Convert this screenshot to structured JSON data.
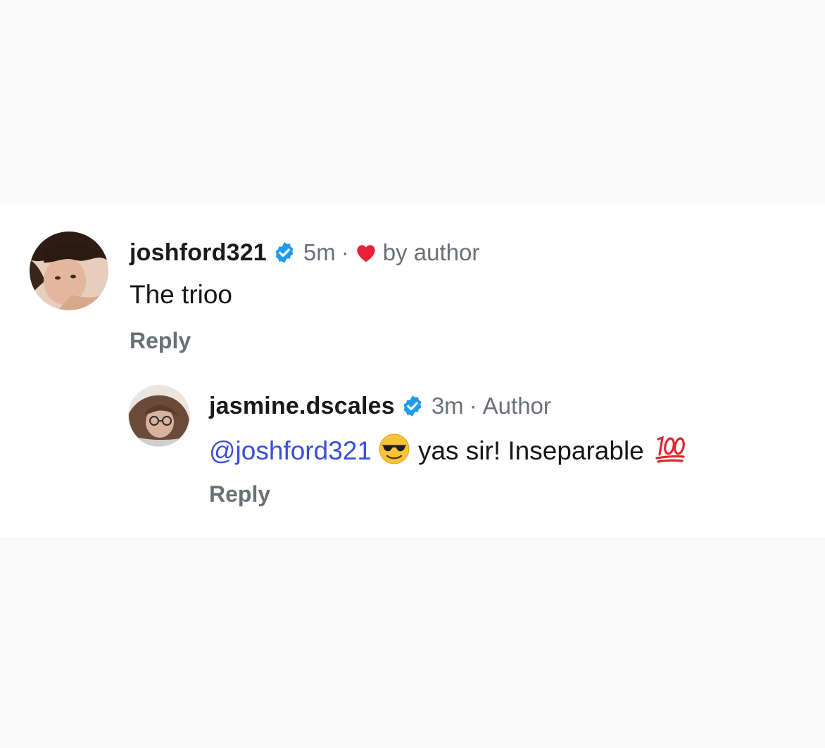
{
  "comments": [
    {
      "username": "joshford321",
      "verified": true,
      "time": "5m",
      "liked_by_author_label": "by author",
      "text": "The trioo",
      "reply_label": "Reply"
    },
    {
      "username": "jasmine.dscales",
      "verified": true,
      "time": "3m",
      "author_badge": "Author",
      "mention": "@joshford321",
      "text": "yas sir! Inseparable",
      "emoji_before_text": "smiling-face-with-sunglasses-emoji",
      "emoji_after_text": "hundred-points-emoji",
      "reply_label": "Reply"
    }
  ],
  "colors": {
    "verified_blue": "#1d9bf0",
    "heart_red": "#e8203a",
    "mention_blue": "#3a4fd8",
    "meta_gray": "#6b6f76"
  },
  "icons": {
    "verified": "verified-badge-icon",
    "heart": "heart-icon"
  }
}
